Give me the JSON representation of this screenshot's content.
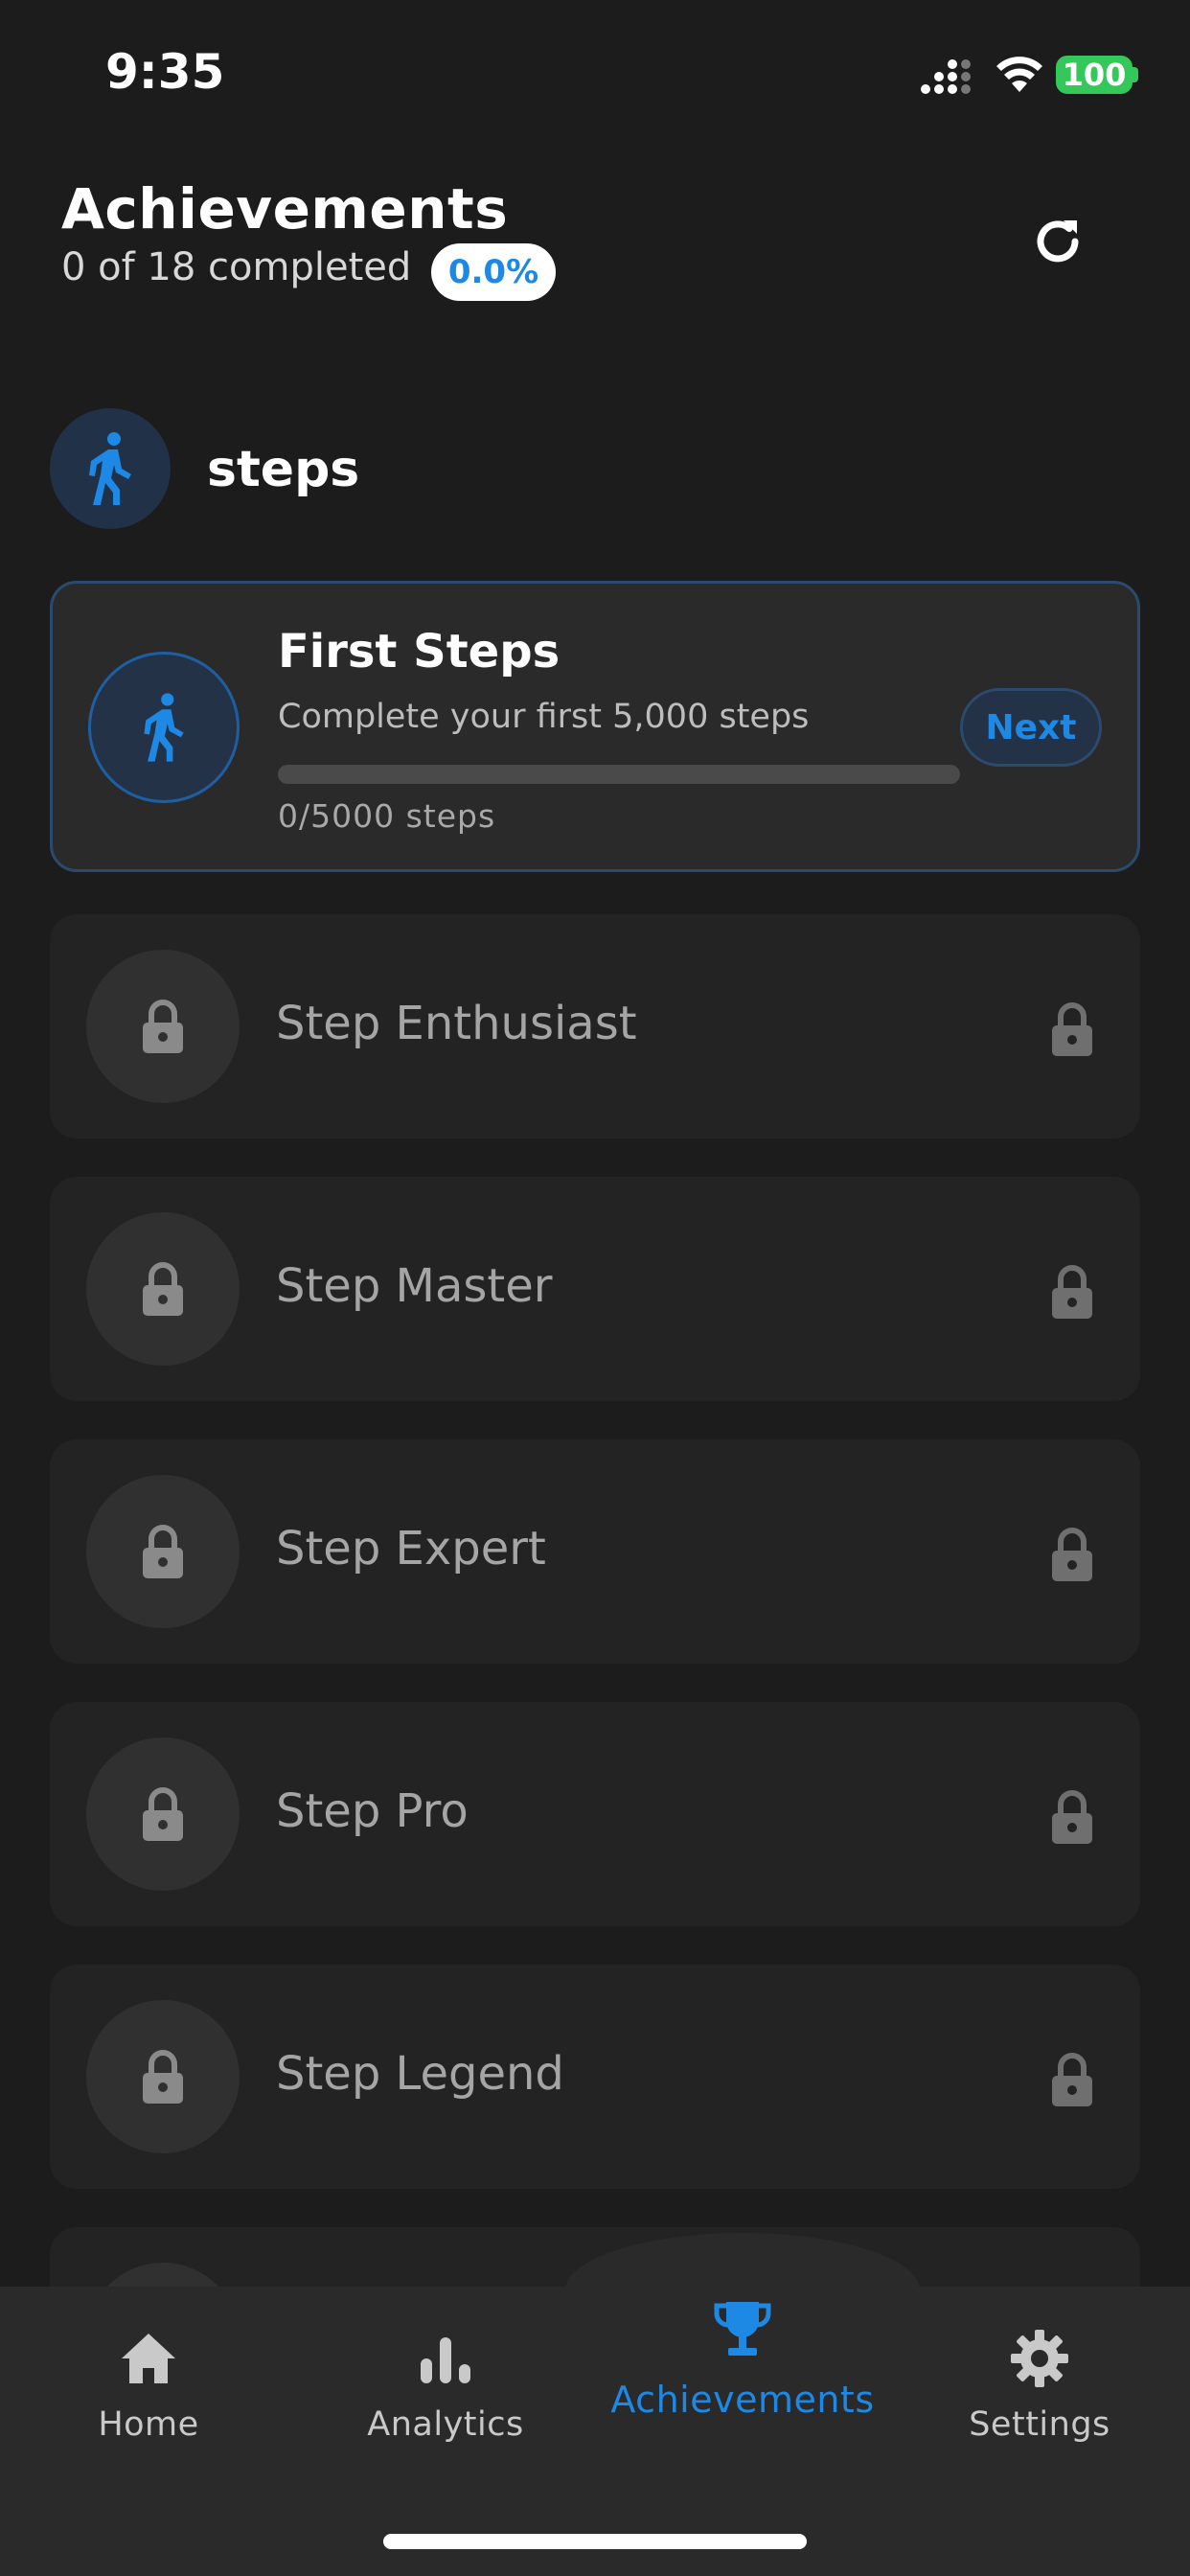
{
  "status_bar": {
    "time": "9:35",
    "battery": "100"
  },
  "header": {
    "title": "Achievements",
    "subtitle": "0 of 18 completed",
    "percent": "0.0%"
  },
  "category": {
    "name": "steps"
  },
  "active_achievement": {
    "title": "First Steps",
    "description": "Complete your first 5,000 steps",
    "progress_text": "0/5000 steps",
    "progress_fraction": 0,
    "next_label": "Next"
  },
  "locked_achievements": [
    {
      "title": "Step Enthusiast"
    },
    {
      "title": "Step Master"
    },
    {
      "title": "Step Expert"
    },
    {
      "title": "Step Pro"
    },
    {
      "title": "Step Legend"
    }
  ],
  "nav": {
    "items": [
      {
        "label": "Home",
        "icon": "home-icon"
      },
      {
        "label": "Analytics",
        "icon": "bar-chart-icon"
      },
      {
        "label": "Achievements",
        "icon": "trophy-icon",
        "active": true
      },
      {
        "label": "Settings",
        "icon": "gear-icon"
      }
    ]
  },
  "colors": {
    "accent": "#1e88e5",
    "background": "#1c1c1c",
    "battery": "#34c759"
  }
}
